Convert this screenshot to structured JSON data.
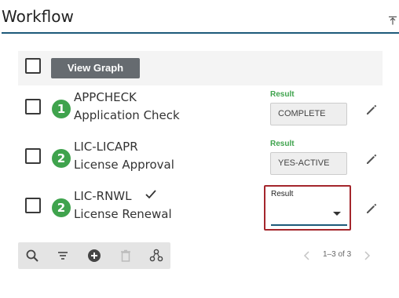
{
  "panel": {
    "title": "Workflow"
  },
  "toolbar": {
    "view_graph_label": "View Graph"
  },
  "rows": [
    {
      "step": "1",
      "code": "APPCHECK",
      "name": "Application Check",
      "result_label": "Result",
      "result_value": "COMPLETE",
      "completed": false
    },
    {
      "step": "2",
      "code": "LIC-LICAPR",
      "name": "License Approval",
      "result_label": "Result",
      "result_value": "YES-ACTIVE",
      "completed": false
    },
    {
      "step": "2",
      "code": "LIC-RNWL",
      "name": "License Renewal",
      "result_label": "Result",
      "result_value": "",
      "completed": true
    }
  ],
  "bottom_toolbar": {
    "icons": [
      "search-icon",
      "filter-icon",
      "add-circle-icon",
      "delete-icon",
      "workflow-icon"
    ]
  },
  "pagination": {
    "range_text": "1–3 of 3"
  },
  "colors": {
    "accent": "#1d5a7a",
    "success": "#3fa34d",
    "focus_border": "#a4262c",
    "button_bg": "#666b70"
  }
}
